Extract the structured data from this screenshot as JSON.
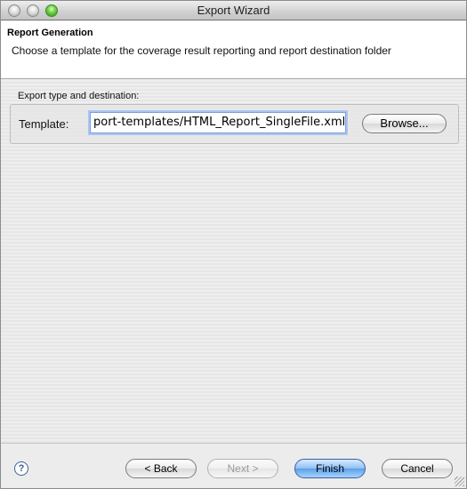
{
  "window": {
    "title": "Export Wizard"
  },
  "banner": {
    "title": "Report Generation",
    "description": "Choose a template for the coverage result reporting and report destination folder"
  },
  "group": {
    "label": "Export type and destination:",
    "template_label": "Template:",
    "template_value": "port-templates/HTML_Report_SingleFile.xml",
    "browse_label": "Browse..."
  },
  "footer": {
    "help_glyph": "?",
    "back_label": "< Back",
    "next_label": "Next >",
    "finish_label": "Finish",
    "cancel_label": "Cancel"
  },
  "icons": {
    "help": "help-icon",
    "close": "close-icon",
    "minimize": "minimize-icon",
    "zoom": "zoom-icon"
  },
  "colors": {
    "default_button_accent": "#5aa0e6",
    "focus_ring": "#a9c6f2"
  }
}
